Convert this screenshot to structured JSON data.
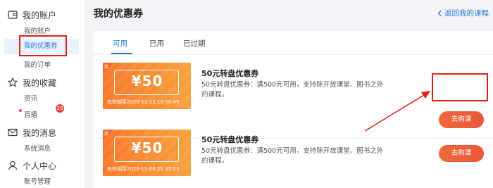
{
  "sidebar": {
    "account": {
      "title": "我的账户",
      "items": [
        "我的账户",
        "我的优惠券",
        "我的订单"
      ]
    },
    "favorites": {
      "title": "我的收藏",
      "items": [
        "资讯",
        "直播"
      ]
    },
    "messages": {
      "title": "我的消息",
      "badge": "29",
      "items": [
        "系统消息"
      ]
    },
    "profile": {
      "title": "个人中心",
      "items": [
        "账号管理"
      ]
    }
  },
  "header": {
    "title": "我的优惠券",
    "back_label": "返回我的课程"
  },
  "tabs": [
    "可用",
    "已用",
    "已过期"
  ],
  "coupons": [
    {
      "corner": "券",
      "price": "¥50",
      "expiry": "有效期至2020-11-13 10:50:49",
      "title": "50元转盘优惠券",
      "desc": "50元转盘优惠券：满500元可用，支持除开放课堂、图书之外的课程。",
      "button": "去购课"
    },
    {
      "corner": "券",
      "price": "¥50",
      "expiry": "有效期至2020-11-08 21:35:13",
      "title": "50元转盘优惠券",
      "desc": "50元转盘优惠券：满500元可用，支持除开放课堂、图书之外的课程。",
      "button": "去购课"
    }
  ],
  "colors": {
    "accent": "#2d7be5",
    "coupon": "#f8782a",
    "button": "#e9573b",
    "annotation": "#e0211a"
  },
  "icons": {
    "account": "wallet-icon",
    "favorites": "star-icon",
    "messages": "mail-icon",
    "profile": "user-icon",
    "back": "chevron-left-icon"
  }
}
